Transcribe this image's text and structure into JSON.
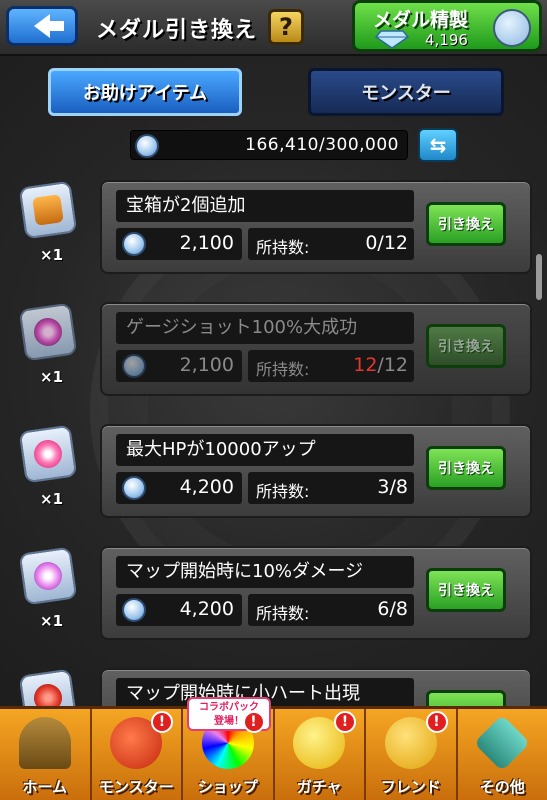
{
  "header": {
    "title": "メダル引き換え",
    "help_label": "?",
    "refine_label": "メダル精製",
    "gem_count": "4,196"
  },
  "tabs": [
    {
      "label": "お助けアイテム",
      "active": true
    },
    {
      "label": "モンスター",
      "active": false
    }
  ],
  "balance": {
    "text": "166,410/300,000"
  },
  "items": [
    {
      "name": "宝箱が2個追加",
      "quantity": "×1",
      "cost": "2,100",
      "owned_label": "所持数:",
      "owned": "0",
      "max": "/12",
      "owned_red": false,
      "enabled": true,
      "button": "引き換え",
      "icon": "treasure-chest-icon"
    },
    {
      "name": "ゲージショット100%大成功",
      "quantity": "×1",
      "cost": "2,100",
      "owned_label": "所持数:",
      "owned": "12",
      "max": "/12",
      "owned_red": true,
      "enabled": false,
      "button": "引き換え",
      "icon": "gauge-shot-icon"
    },
    {
      "name": "最大HPが10000アップ",
      "quantity": "×1",
      "cost": "4,200",
      "owned_label": "所持数:",
      "owned": "3",
      "max": "/8",
      "owned_red": false,
      "enabled": true,
      "button": "引き換え",
      "icon": "heart-plus-icon"
    },
    {
      "name": "マップ開始時に10%ダメージ",
      "quantity": "×1",
      "cost": "4,200",
      "owned_label": "所持数:",
      "owned": "6",
      "max": "/8",
      "owned_red": false,
      "enabled": true,
      "button": "引き換え",
      "icon": "sparkle-burst-icon"
    },
    {
      "name": "マップ開始時に小ハート出現",
      "quantity": "",
      "cost": "",
      "owned_label": "",
      "owned": "",
      "max": "",
      "owned_red": false,
      "enabled": true,
      "button": "",
      "icon": "red-heart-icon"
    }
  ],
  "bottom_nav": [
    {
      "label": "ホーム",
      "badge": "",
      "icon": "home-gate-icon"
    },
    {
      "label": "モンスター",
      "badge": "!",
      "icon": "monster-icon"
    },
    {
      "label": "ショップ",
      "badge": "!",
      "icon": "rainbow-orb-icon",
      "collab": "コラボパック\n登場！"
    },
    {
      "label": "ガチャ",
      "badge": "!",
      "icon": "gacha-egg-icon"
    },
    {
      "label": "フレンド",
      "badge": "!",
      "icon": "friends-icon"
    },
    {
      "label": "その他",
      "badge": "",
      "icon": "other-menu-icon"
    }
  ]
}
